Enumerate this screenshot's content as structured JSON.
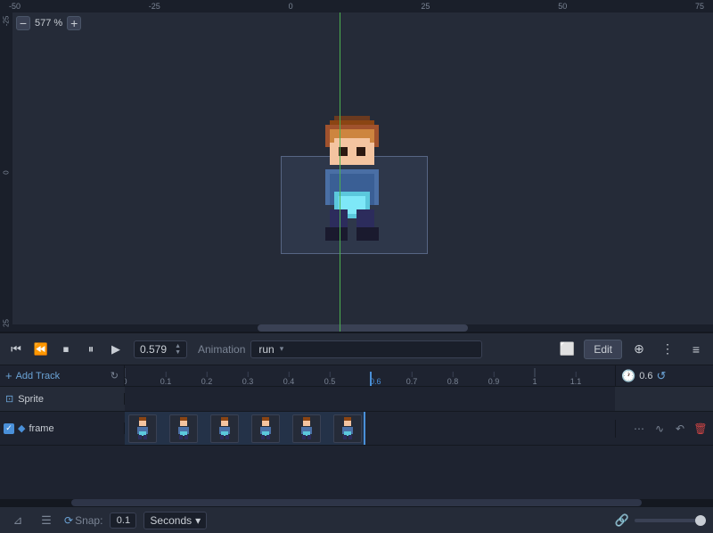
{
  "viewport": {
    "zoom": "577 %",
    "zoom_minus": "−",
    "zoom_plus": "+"
  },
  "ruler": {
    "top_labels": [
      "-50",
      "-25",
      "0",
      "25",
      "50",
      "75"
    ],
    "left_labels": [
      "-25",
      "0",
      "25"
    ]
  },
  "transport": {
    "time_value": "0.579",
    "anim_label": "Animation",
    "anim_name": "run",
    "edit_btn": "Edit",
    "buttons": {
      "prev_keyframe": "⏮",
      "prev_frame": "⏪",
      "stop": "⏹",
      "pause": "⏸",
      "play": "▶"
    }
  },
  "track_ruler": {
    "add_track": "+ Add Track",
    "marks": [
      "0",
      "0.1",
      "0.2",
      "0.3",
      "0.4",
      "0.5",
      "0.6",
      "0.7",
      "0.8",
      "0.9",
      "1",
      "1.1"
    ],
    "loop_time": "0.6"
  },
  "sprite_track": {
    "name": "Sprite",
    "icon": "🖼"
  },
  "frame_track": {
    "name": "frame",
    "checked": true,
    "keyframe_positions": [
      0,
      46,
      92,
      138,
      184,
      230
    ]
  },
  "bottom_bar": {
    "snap_label": "Snap:",
    "snap_value": "0.1",
    "seconds_label": "Seconds",
    "seconds_chevron": "▾"
  }
}
